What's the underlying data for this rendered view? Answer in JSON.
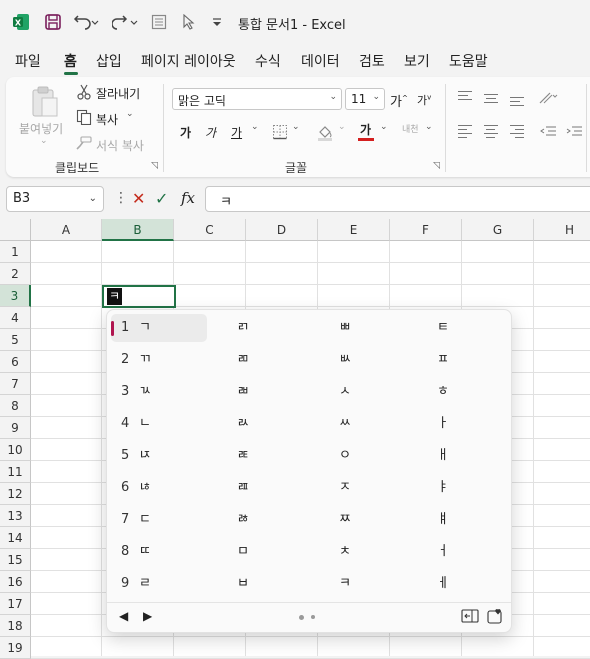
{
  "titlebar": {
    "app_icon": "X",
    "title": "통합 문서1  -  Excel",
    "icons": [
      "excel-icon",
      "save-icon",
      "undo-icon",
      "redo-icon",
      "form-icon",
      "pointer-icon",
      "customize-icon"
    ]
  },
  "menu": {
    "tabs": [
      "파일",
      "홈",
      "삽입",
      "페이지 레이아웃",
      "수식",
      "데이터",
      "검토",
      "보기",
      "도움말"
    ],
    "active": "홈"
  },
  "ribbon": {
    "clipboard": {
      "paste": "붙여넣기",
      "cut": "잘라내기",
      "copy": "복사",
      "format_painter": "서식 복사",
      "label": "클립보드"
    },
    "font": {
      "font_name": "맑은 고딕",
      "font_size": "11",
      "grow": "가",
      "shrink": "가",
      "bold": "가",
      "italic": "가",
      "underline": "가",
      "font_color": "가",
      "phonetic": "내천",
      "font_color_hex": "#d41f1f",
      "label": "글꼴"
    }
  },
  "formula_bar": {
    "name_box": "B3",
    "fx": "fx",
    "cancel": "✕",
    "enter": "✓",
    "value": "ㅋ"
  },
  "sheet": {
    "columns": [
      "A",
      "B",
      "C",
      "D",
      "E",
      "F",
      "G",
      "H"
    ],
    "rows": [
      "1",
      "2",
      "3",
      "4",
      "5",
      "6",
      "7",
      "8",
      "9",
      "10",
      "11",
      "12",
      "13",
      "14",
      "15",
      "16",
      "17",
      "18",
      "19"
    ],
    "selected_column": "B",
    "selected_row": "3",
    "active_cell_text": "ㅋ",
    "accent": "#217346"
  },
  "ime": {
    "numbers": [
      "1",
      "2",
      "3",
      "4",
      "5",
      "6",
      "7",
      "8",
      "9"
    ],
    "columns": [
      [
        "ㄱ",
        "ㄲ",
        "ㄳ",
        "ㄴ",
        "ㄵ",
        "ㄶ",
        "ㄷ",
        "ㄸ",
        "ㄹ"
      ],
      [
        "ㄺ",
        "ㄻ",
        "ㄼ",
        "ㄽ",
        "ㄾ",
        "ㄿ",
        "ㅀ",
        "ㅁ",
        "ㅂ"
      ],
      [
        "ㅃ",
        "ㅄ",
        "ㅅ",
        "ㅆ",
        "ㅇ",
        "ㅈ",
        "ㅉ",
        "ㅊ",
        "ㅋ"
      ],
      [
        "ㅌ",
        "ㅍ",
        "ㅎ",
        "ㅏ",
        "ㅐ",
        "ㅑ",
        "ㅒ",
        "ㅓ",
        "ㅔ"
      ]
    ],
    "prev": "◀",
    "next": "▶",
    "selection_color": "#b0154f"
  }
}
